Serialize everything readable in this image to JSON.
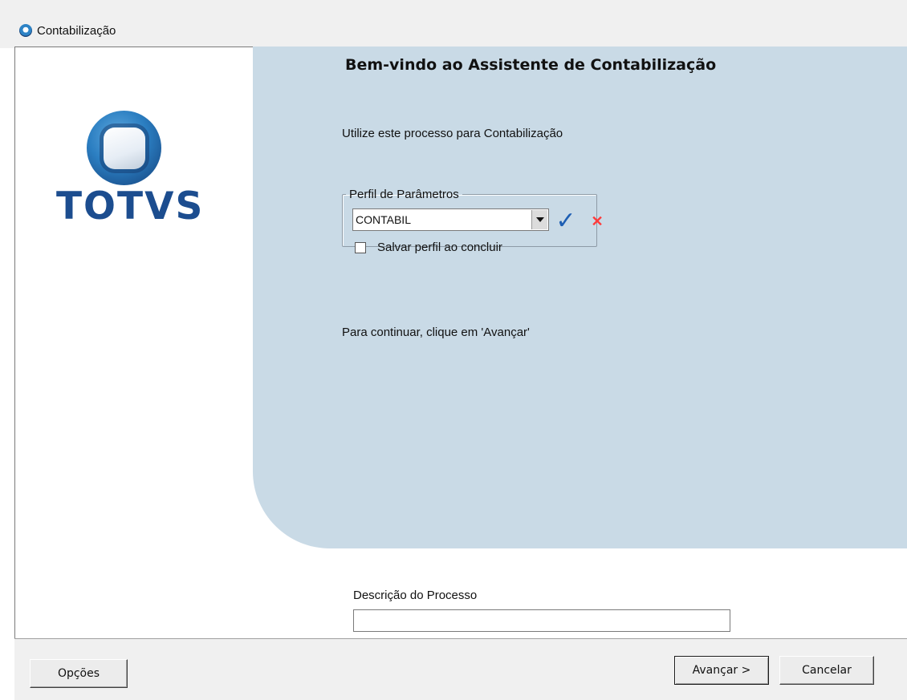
{
  "window": {
    "title": "Contabilização"
  },
  "logo": {
    "text": "TOTVS"
  },
  "wizard": {
    "heading": "Bem-vindo ao Assistente de Contabilização",
    "intro": "Utilize este processo para Contabilização",
    "continue_hint": "Para continuar, clique em 'Avançar'"
  },
  "profile": {
    "legend": "Perfil de Parâmetros",
    "selected": "CONTABIL",
    "save_checkbox_label": "Salvar perfil ao concluir",
    "save_checked": false
  },
  "description": {
    "label": "Descrição do Processo",
    "value": ""
  },
  "footer": {
    "options_label": "Opções",
    "next_label": "Avançar >",
    "cancel_label": "Cancelar"
  },
  "icons": {
    "confirm": "checkmark-icon",
    "clear": "x-icon",
    "dropdown": "chevron-down-icon"
  },
  "colors": {
    "panel_bg": "#c9dae6",
    "brand_blue": "#1c4d8f",
    "confirm_blue": "#1d5eb3",
    "clear_red": "#ff3a3a"
  }
}
